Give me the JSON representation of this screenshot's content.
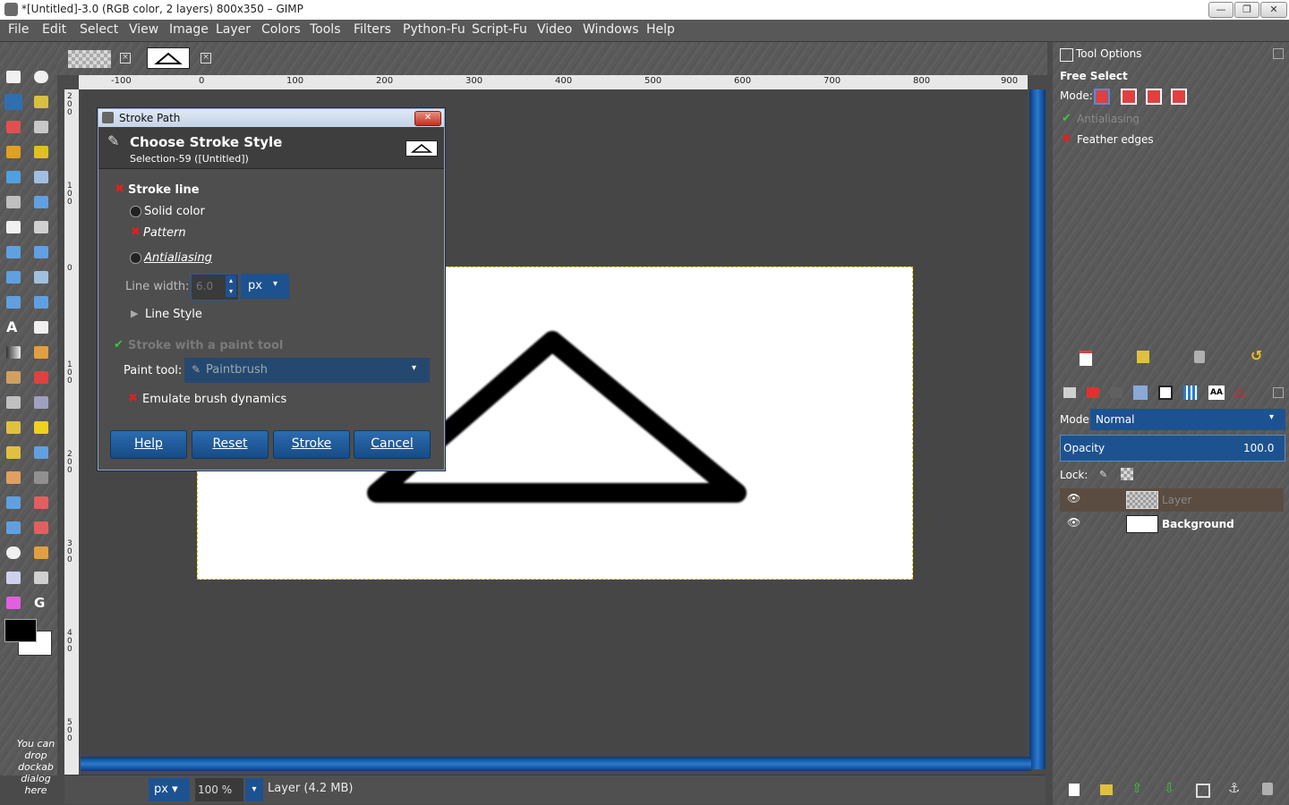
{
  "window": {
    "title": "*[Untitled]-3.0 (RGB color, 2 layers) 800x350 – GIMP",
    "min_glyph": "—",
    "max_glyph": "❐",
    "close_glyph": "✕"
  },
  "menu": [
    "File",
    "Edit",
    "Select",
    "View",
    "Image",
    "Layer",
    "Colors",
    "Tools",
    "Filters",
    "Python-Fu",
    "Script-Fu",
    "Video",
    "Windows",
    "Help"
  ],
  "toolbox": {
    "drop_note": "You can drop dockab dialog here"
  },
  "ruler_h": [
    "-100",
    "0",
    "100",
    "200",
    "300",
    "400",
    "500",
    "600",
    "700",
    "800",
    "900"
  ],
  "ruler_v": [
    "2\n0\n0",
    "1\n0\n0",
    "0",
    "1\n0\n0",
    "2\n0\n0",
    "3\n0\n0",
    "4\n0\n0",
    "5\n0\n0"
  ],
  "statusbar": {
    "unit": "px",
    "zoom": "100",
    "zoom_suffix": "%",
    "layer_info": "Layer (4.2 MB)"
  },
  "tool_options": {
    "header": "Tool Options",
    "tool_name": "Free Select",
    "mode_label": "Mode:",
    "antialiasing": "Antialiasing",
    "feather_edges": "Feather edges"
  },
  "layers": {
    "mode_label": "Mode:",
    "mode_value": "Normal",
    "opacity_label": "Opacity",
    "opacity_value": "100.0",
    "lock_label": "Lock:",
    "items": [
      {
        "name": "Layer",
        "selected": true
      },
      {
        "name": "Background",
        "selected": false
      }
    ]
  },
  "dialog": {
    "title": "Stroke Path",
    "heading": "Choose Stroke Style",
    "subheading": "Selection-59 ([Untitled])",
    "stroke_line": "Stroke line",
    "solid_color": "Solid color",
    "pattern": "Pattern",
    "antialiasing": "Antialiasing",
    "line_width_label": "Line width:",
    "line_width_value": "6.0",
    "line_width_unit": "px",
    "line_style": "Line Style",
    "stroke_paint_tool": "Stroke with a paint tool",
    "paint_tool_label": "Paint tool:",
    "paint_tool_value": "Paintbrush",
    "emulate_dynamics": "Emulate brush dynamics",
    "buttons": {
      "help": "Help",
      "reset": "Reset",
      "stroke": "Stroke",
      "cancel": "Cancel"
    }
  }
}
